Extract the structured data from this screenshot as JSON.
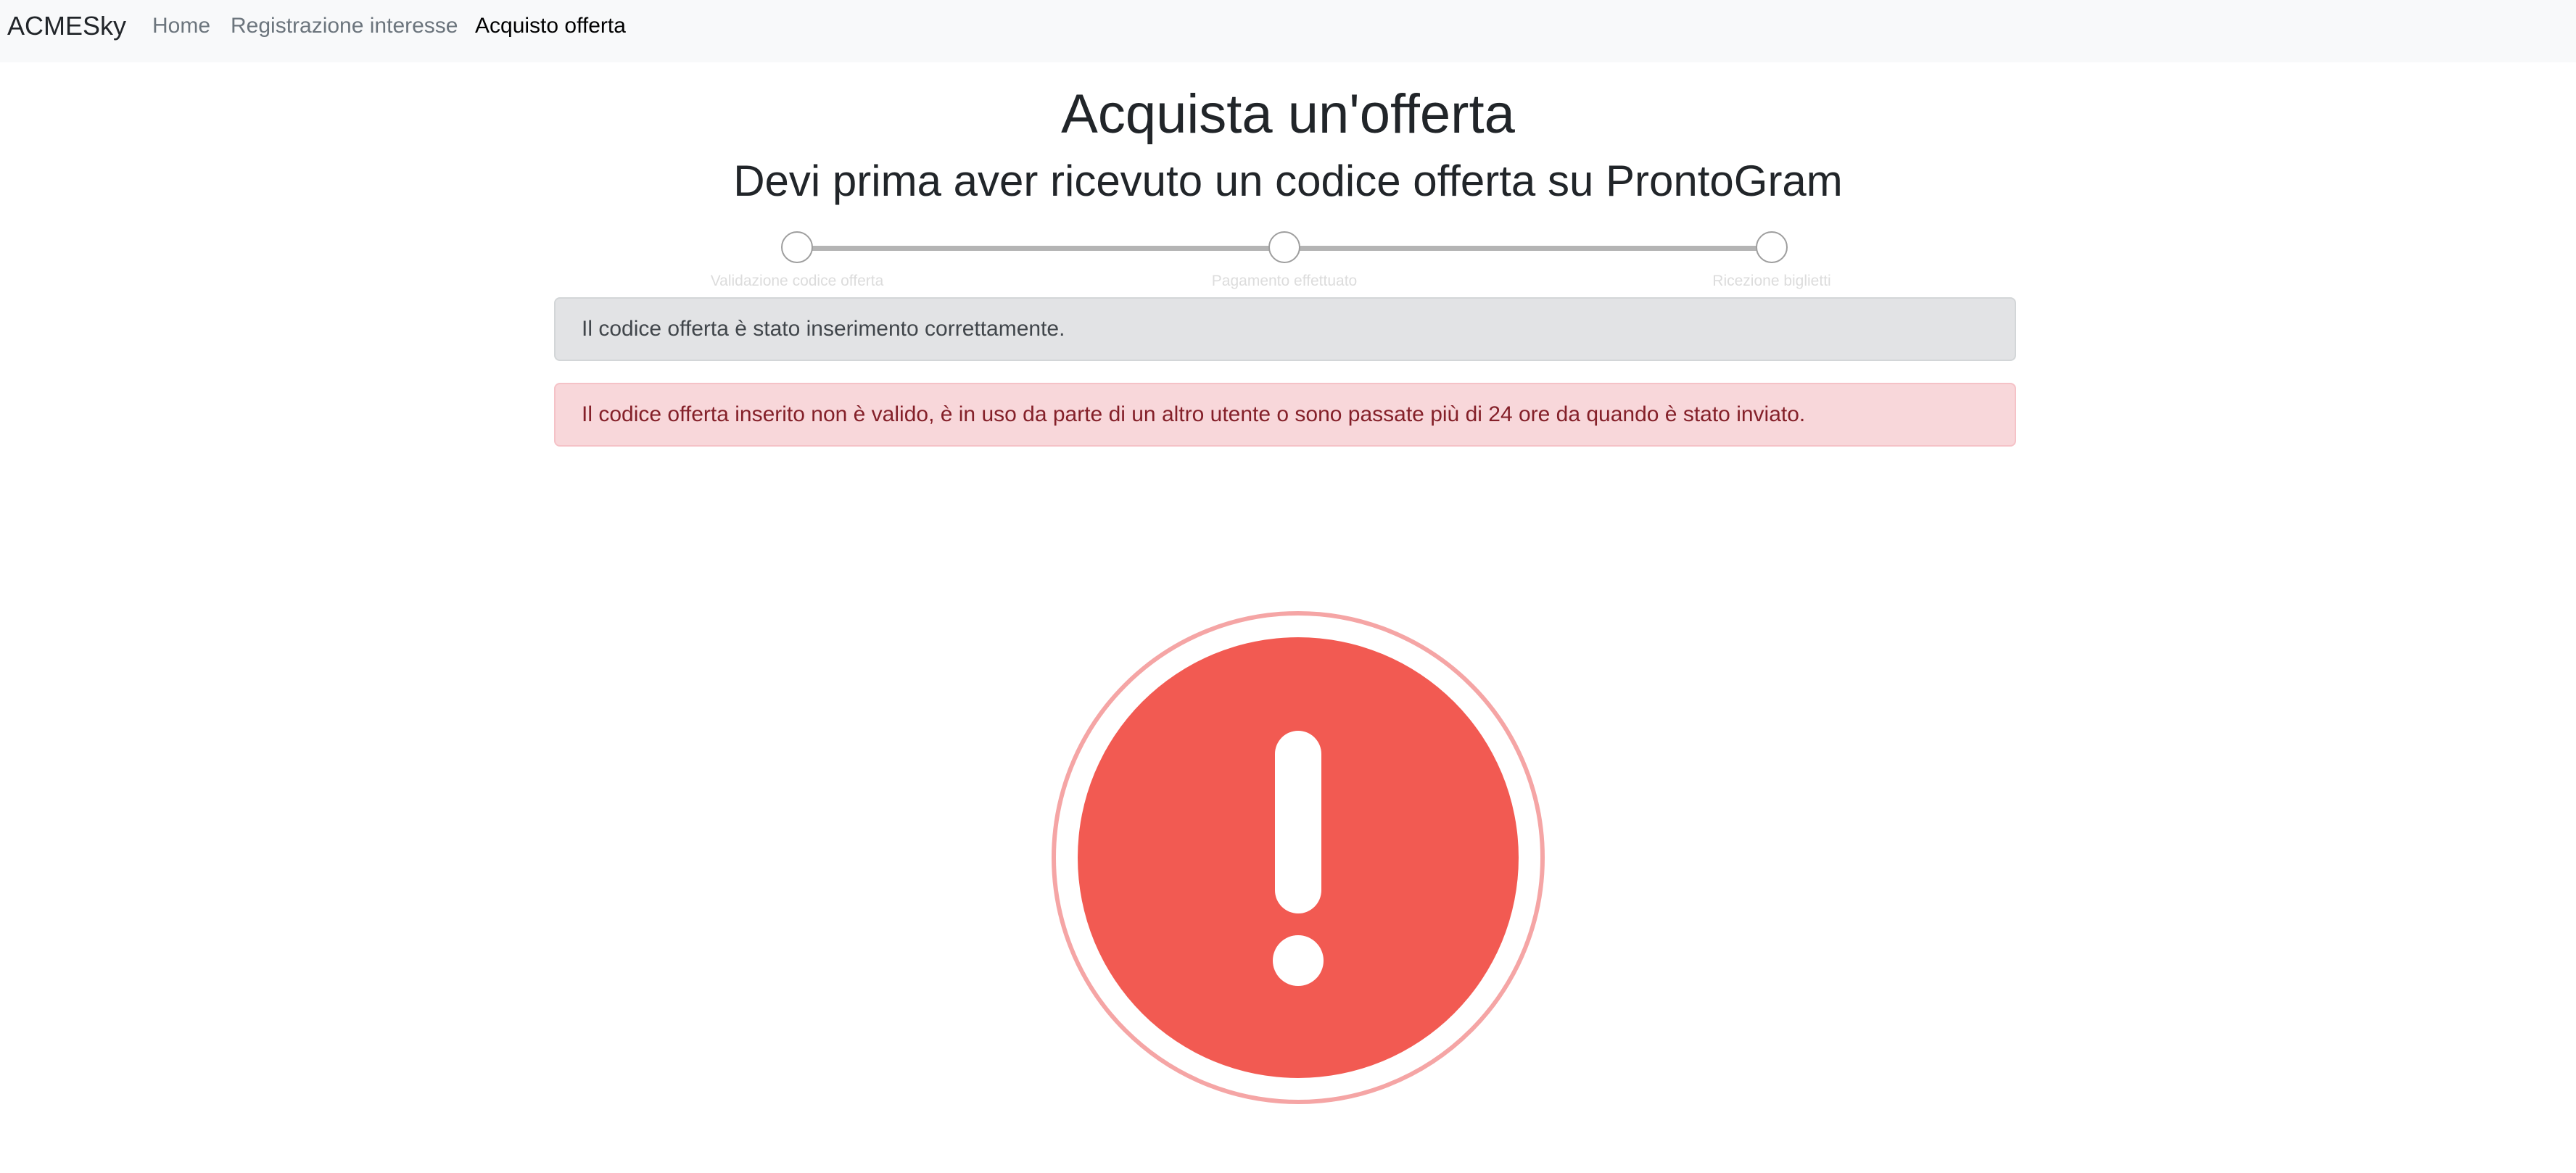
{
  "navbar": {
    "brand": "ACMESky",
    "links": [
      {
        "label": "Home",
        "active": false
      },
      {
        "label": "Registrazione interesse",
        "active": false
      },
      {
        "label": "Acquisto offerta",
        "active": true
      }
    ]
  },
  "page": {
    "title": "Acquista un'offerta",
    "subtitle": "Devi prima aver ricevuto un codice offerta su ProntoGram"
  },
  "stepper": {
    "steps": [
      {
        "label": "Validazione codice offerta"
      },
      {
        "label": "Pagamento effettuato"
      },
      {
        "label": "Ricezione biglietti"
      }
    ]
  },
  "alerts": {
    "info": "Il codice offerta è stato inserimento correttamente.",
    "error": "Il codice offerta inserito non è valido, è in uso da parte di un altro utente o sono passate più di 24 ore da quando è stato inviato."
  },
  "status_icon": {
    "icon": "exclamation-icon",
    "color": "#f27474",
    "ring_color": "#f5a5a5"
  }
}
